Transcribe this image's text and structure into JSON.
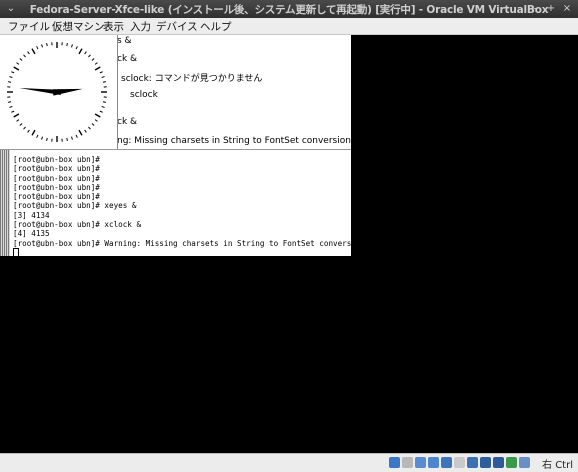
{
  "window": {
    "title": "Fedora-Server-Xfce-like (インストール後、システム更新して再起動) [実行中] - Oracle VM VirtualBox",
    "controls": {
      "menu": "⌄",
      "minimize": "–",
      "maximize": "+",
      "close": "×"
    }
  },
  "menubar": {
    "items": [
      {
        "label": "ファイル"
      },
      {
        "label": "仮想マシン"
      },
      {
        "label": "表示"
      },
      {
        "label": "入力"
      },
      {
        "label": "デバイス"
      },
      {
        "label": "ヘルプ"
      }
    ]
  },
  "xclock": {
    "hour": 2,
    "minute": 46
  },
  "terminal_back": {
    "lines": [
      "s &",
      "ck &",
      "sclock: コマンドが見つかりません",
      "sclock",
      "ck &",
      "ng: Missing charsets in String to FontSet conversion"
    ]
  },
  "terminal_front": {
    "lines": [
      "[root@ubn-box ubn]#",
      "[root@ubn-box ubn]#",
      "[root@ubn-box ubn]#",
      "[root@ubn-box ubn]#",
      "[root@ubn-box ubn]#",
      "[root@ubn-box ubn]# xeyes &",
      "[3] 4134",
      "[root@ubn-box ubn]# xclock &",
      "[4] 4135",
      "[root@ubn-box ubn]# Warning: Missing charsets in String to FontSet conversion"
    ]
  },
  "statusbar": {
    "host_key": "右 Ctrl",
    "icons": [
      {
        "name": "hard-disk-icon",
        "color": "#3a78c6"
      },
      {
        "name": "optical-drive-icon",
        "color": "#b8b8b8"
      },
      {
        "name": "audio-icon",
        "color": "#5a8bd0"
      },
      {
        "name": "network-icon",
        "color": "#4c86cf"
      },
      {
        "name": "usb-icon",
        "color": "#3f74b8"
      },
      {
        "name": "shared-folders-icon",
        "color": "#c9c9c9"
      },
      {
        "name": "display-icon",
        "color": "#3d6fb3"
      },
      {
        "name": "video-capture-icon",
        "color": "#2e5f9c"
      },
      {
        "name": "recording-icon",
        "color": "#2f5a96"
      },
      {
        "name": "mouse-integration-icon",
        "color": "#3b9a4a"
      },
      {
        "name": "cpu-icon",
        "color": "#6a8fc4"
      }
    ]
  }
}
